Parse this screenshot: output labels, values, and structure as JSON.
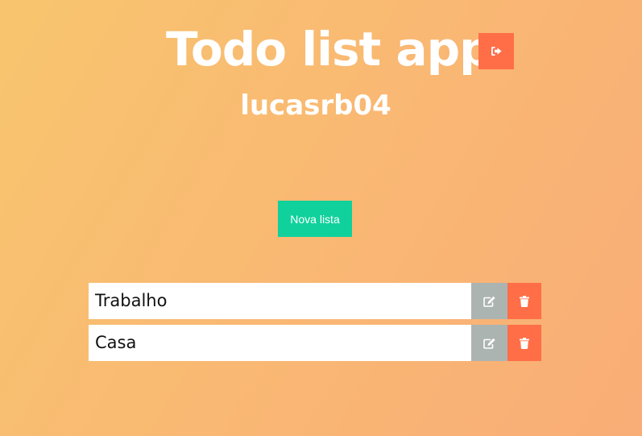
{
  "header": {
    "title": "Todo list app",
    "logout_icon": "sign-out-icon"
  },
  "user": {
    "username": "lucasrb04"
  },
  "actions": {
    "new_list_label": "Nova lista"
  },
  "lists": [
    {
      "name": "Trabalho",
      "edit_icon": "edit-icon",
      "delete_icon": "trash-icon"
    },
    {
      "name": "Casa",
      "edit_icon": "edit-icon",
      "delete_icon": "trash-icon"
    }
  ],
  "colors": {
    "accent_orange": "#ff6e47",
    "accent_green": "#10d19c",
    "edit_gray": "#acb4b1",
    "bg_gradient_start": "#f8c56e",
    "bg_gradient_end": "#f9ad77"
  }
}
